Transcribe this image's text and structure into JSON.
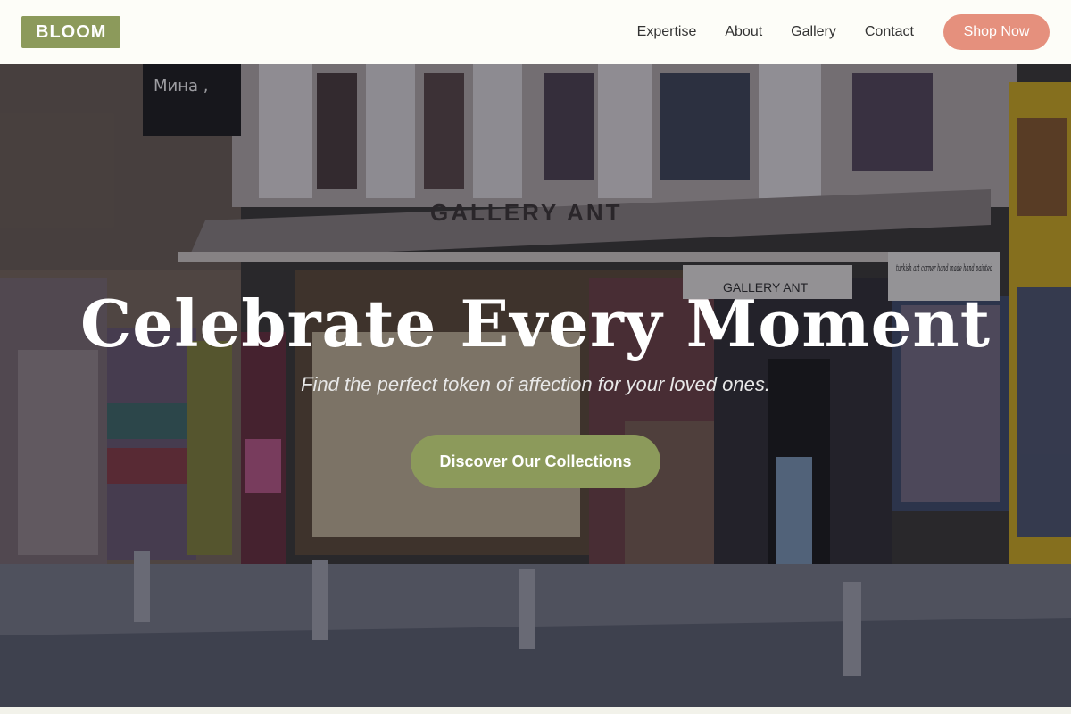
{
  "header": {
    "logo": "BLOOM",
    "nav": [
      "Expertise",
      "About",
      "Gallery",
      "Contact"
    ],
    "cta": "Shop Now"
  },
  "hero": {
    "title": "Celebrate Every Moment",
    "subtitle": "Find the perfect token of affection for your loved ones.",
    "cta": "Discover Our Collections",
    "photo_signs": {
      "awning": "GALLERY ANT",
      "small_sign": "GALLERY ANT",
      "hand_sign": "turkish art corner hand made hand painted",
      "top_sign": "Мина ,"
    }
  },
  "colors": {
    "accent": "#8c9a5b",
    "shop_button": "#e5907d",
    "header_bg": "#fdfdf8"
  }
}
